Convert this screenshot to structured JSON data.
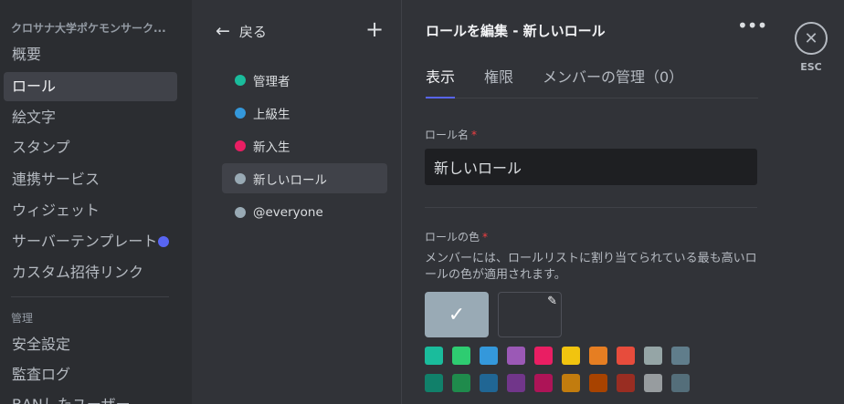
{
  "sidebar": {
    "server_name": "クロサナ大学ポケモンサーク...",
    "items": [
      {
        "label": "概要",
        "active": false
      },
      {
        "label": "ロール",
        "active": true
      },
      {
        "label": "絵文字",
        "active": false
      },
      {
        "label": "スタンプ",
        "active": false
      },
      {
        "label": "連携サービス",
        "active": false
      },
      {
        "label": "ウィジェット",
        "active": false
      },
      {
        "label": "サーバーテンプレート",
        "active": false,
        "dot": true
      },
      {
        "label": "カスタム招待リンク",
        "active": false
      }
    ],
    "section_label": "管理",
    "section_items": [
      {
        "label": "安全設定"
      },
      {
        "label": "監査ログ"
      },
      {
        "label": "BANしたユーザー"
      }
    ]
  },
  "role_list": {
    "back_label": "戻る",
    "add_icon": "plus-icon",
    "roles": [
      {
        "name": "管理者",
        "color": "#1abc9c",
        "active": false
      },
      {
        "name": "上級生",
        "color": "#3498db",
        "active": false
      },
      {
        "name": "新入生",
        "color": "#e91e63",
        "active": false
      },
      {
        "name": "新しいロール",
        "color": "#99aab5",
        "active": true
      },
      {
        "name": "@everyone",
        "color": "#99aab5",
        "active": false
      }
    ]
  },
  "editor": {
    "title": "ロールを編集 - 新しいロール",
    "more_icon": "more-icon",
    "tabs": [
      {
        "label": "表示",
        "active": true
      },
      {
        "label": "権限",
        "active": false
      },
      {
        "label": "メンバーの管理（0）",
        "active": false
      }
    ],
    "role_name_label": "ロール名",
    "role_name_value": "新しいロール",
    "role_color_label": "ロールの色",
    "required_mark": "*",
    "color_description": "メンバーには、ロールリストに割り当てられている最も高いロールの色が適用されます。",
    "default_color": "#99aab5",
    "check_icon": "check-icon",
    "picker_icon": "eyedropper-icon",
    "swatch_rows": [
      [
        "#1abc9c",
        "#2ecc71",
        "#3498db",
        "#9b59b6",
        "#e91e63",
        "#f1c40f",
        "#e67e22",
        "#e74c3c",
        "#95a5a6",
        "#607d8b"
      ],
      [
        "#11806a",
        "#1f8b4c",
        "#206694",
        "#71368a",
        "#ad1457",
        "#c27c0e",
        "#a84300",
        "#992d22",
        "#979c9f",
        "#546e7a"
      ]
    ]
  },
  "close": {
    "icon": "close-icon",
    "esc_label": "ESC"
  }
}
